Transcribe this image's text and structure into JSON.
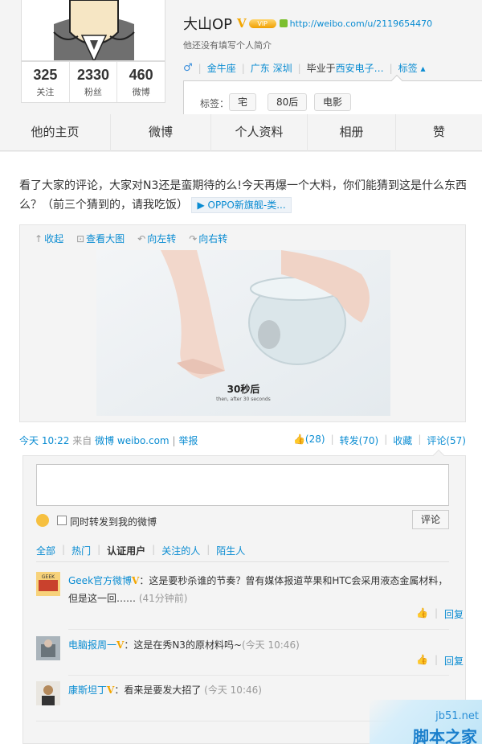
{
  "profile": {
    "name": "大山OP",
    "verified_badge": "V",
    "url": "http://weibo.com/u/2119654470",
    "intro": "他还没有填写个人简介",
    "gender_symbol": "♂",
    "zodiac": "金牛座",
    "location": "广东 深圳",
    "education_prefix": "毕业于",
    "education": "西安电子…",
    "tag_toggle": "标签 ▴",
    "stats": [
      {
        "num": "325",
        "label": "关注"
      },
      {
        "num": "2330",
        "label": "粉丝"
      },
      {
        "num": "460",
        "label": "微博"
      }
    ],
    "tags_label": "标签：",
    "tags": [
      "宅",
      "80后",
      "电影"
    ]
  },
  "nav": {
    "tabs": [
      "他的主页",
      "微博",
      "个人资料",
      "相册",
      "赞"
    ]
  },
  "post": {
    "text": "看了大家的评论，大家对N3还是蛮期待的么!今天再爆一个大料，你们能猜到这是什么东西么？（前三个猜到的，请我吃饭）",
    "video_link": "OPPO新旗舰-类...",
    "media_actions": [
      "收起",
      "查看大图",
      "向左转",
      "向右转"
    ],
    "image_caption": "30秒后",
    "image_caption_sub": "then, after 30 seconds",
    "time": "今天 10:22",
    "source_prefix": "来自",
    "source": "微博 weibo.com",
    "report": "举报",
    "like": "(28)",
    "repost": "转发(70)",
    "favorite": "收藏",
    "comment": "评论(57)"
  },
  "comments": {
    "also_repost_label": "同时转发到我的微博",
    "submit": "评论",
    "filters": [
      "全部",
      "热门",
      "认证用户",
      "关注的人",
      "陌生人"
    ],
    "active_filter": 2,
    "reply": "回复",
    "items": [
      {
        "user": "Geek官方微博",
        "badge": "V",
        "text": "：这是要秒杀谁的节奏？曾有媒体报道苹果和HTC会采用液态金属材料，但是这一回……",
        "time": "(41分钟前)"
      },
      {
        "user": "电脑报周一",
        "badge": "V",
        "text": "：这是在秀N3的原材料吗~",
        "time": "(今天 10:46)"
      },
      {
        "user": "康斯坦丁",
        "badge": "V",
        "text": "：看来是要发大招了",
        "time": "(今天 10:46)"
      }
    ]
  },
  "watermark": {
    "line1": "jb51.net",
    "line2": "脚本之家"
  },
  "colors": {
    "link": "#0a8cd2",
    "vip": "#f3a600"
  }
}
